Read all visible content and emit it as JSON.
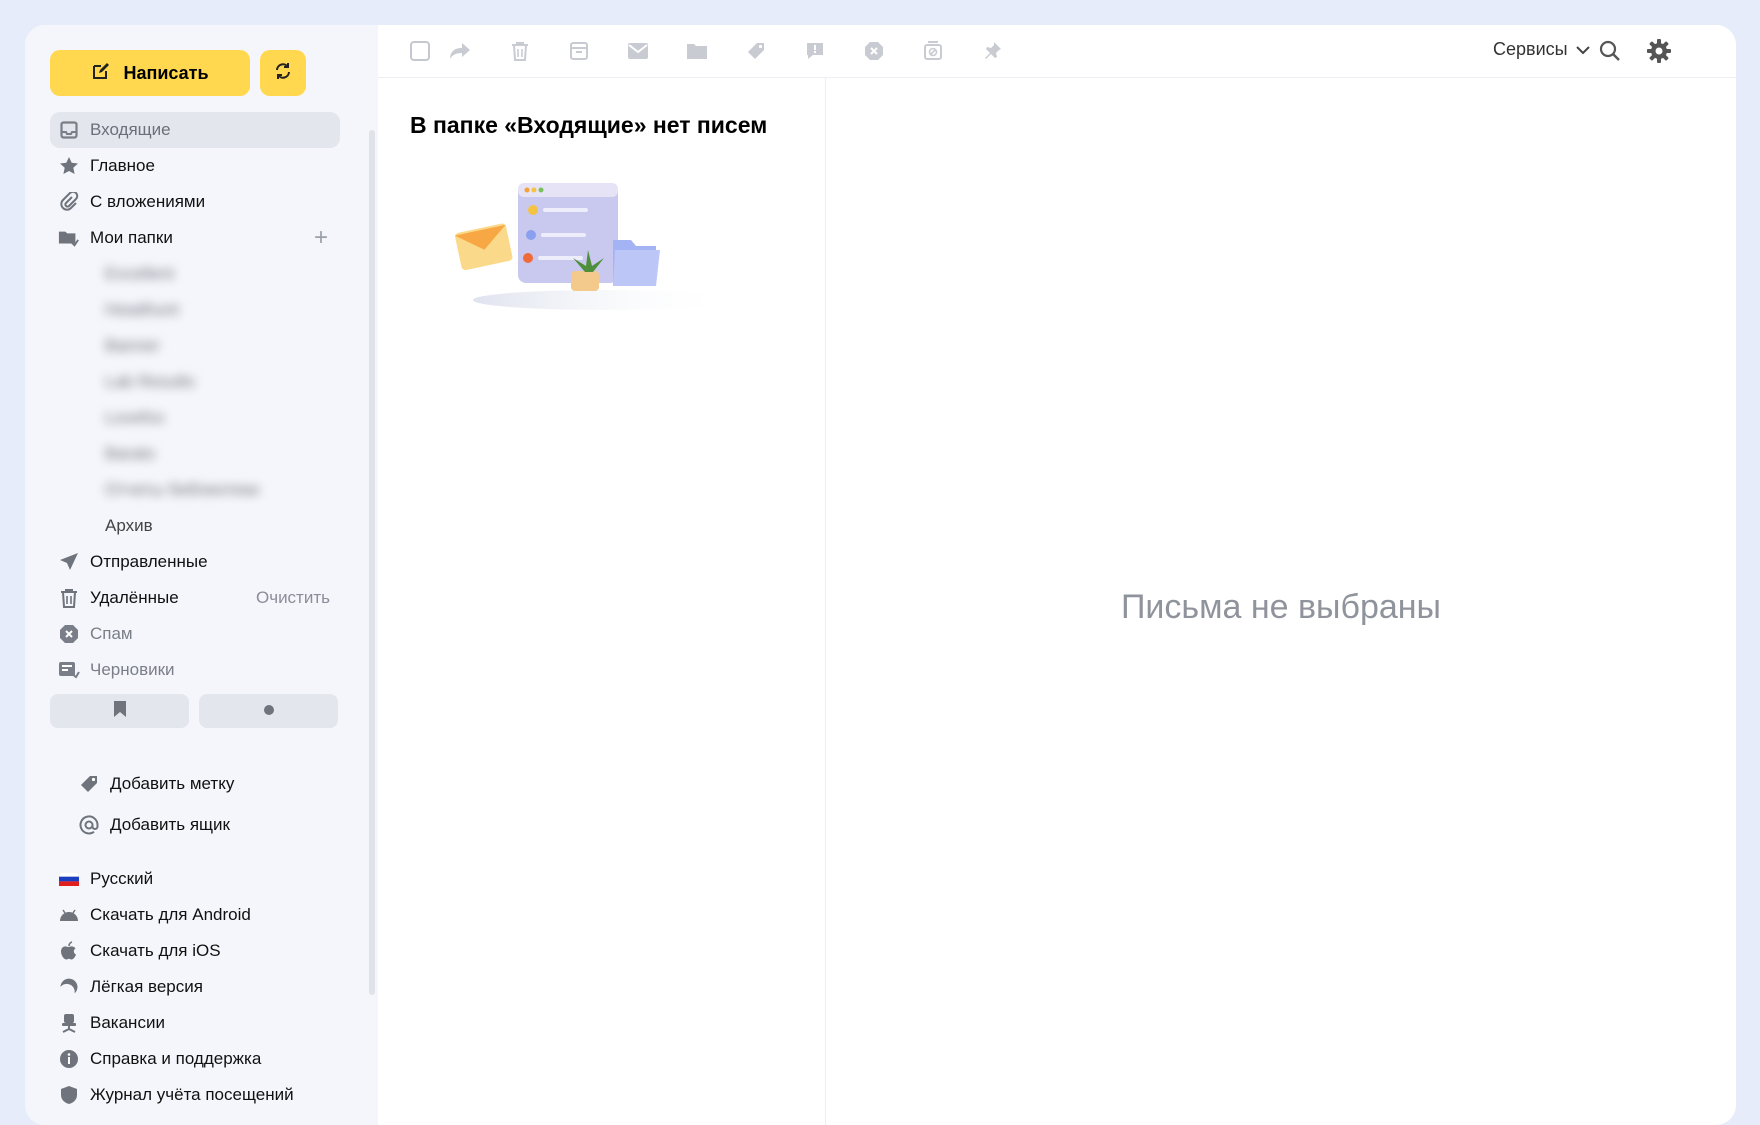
{
  "compose": {
    "label": "Написать"
  },
  "nav": {
    "inbox": "Входящие",
    "main": "Главное",
    "attachments": "С вложениями",
    "my_folders": "Мои папки",
    "subfolders": [
      "Excellent",
      "Headhunt",
      "Banner",
      "Lab Results",
      "Lovefox",
      "Barato",
      "Отчеты библиотеки"
    ],
    "archive": "Архив",
    "sent": "Отправленные",
    "deleted": "Удалённые",
    "deleted_action": "Очистить",
    "spam": "Спам",
    "drafts": "Черновики"
  },
  "extras": {
    "add_label": "Добавить метку",
    "add_mailbox": "Добавить ящик"
  },
  "footer": {
    "language": "Русский",
    "android": "Скачать для Android",
    "ios": "Скачать для iOS",
    "lite": "Лёгкая версия",
    "jobs": "Вакансии",
    "help": "Справка и поддержка",
    "log": "Журнал учёта посещений"
  },
  "toolbar": {
    "services": "Сервисы"
  },
  "list": {
    "empty_title": "В папке «Входящие» нет писем"
  },
  "reading": {
    "empty_text": "Письма не выбраны"
  },
  "colors": {
    "accent": "#ffd84f",
    "notification": "#f0211d",
    "avatar_ring": "#a24cf0"
  }
}
